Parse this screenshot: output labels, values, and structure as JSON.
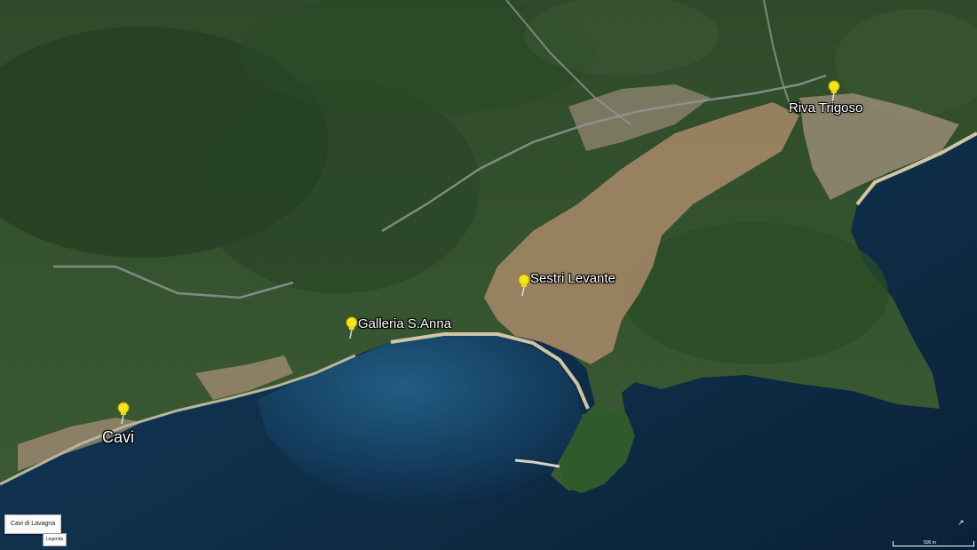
{
  "map": {
    "colors": {
      "sea_deep": "#0c2843",
      "sea_shallow": "#1f5a7e",
      "forest": "#2b4a28",
      "town": "#b8906d",
      "beach": "#c9c1a5"
    },
    "pins": [
      {
        "name": "Riva Trigoso",
        "icon": "yellow-pushpin-icon"
      },
      {
        "name": "Sestri Levante",
        "icon": "yellow-pushpin-icon"
      },
      {
        "name": "Galleria S.Anna",
        "icon": "yellow-pushpin-icon"
      },
      {
        "name": "Cavi",
        "icon": "yellow-pushpin-icon"
      }
    ],
    "place_box": "Cavi di Lavagna",
    "legend_button": "Legenda",
    "scale": "500 m",
    "compass_icon": "north-arrow-icon"
  }
}
